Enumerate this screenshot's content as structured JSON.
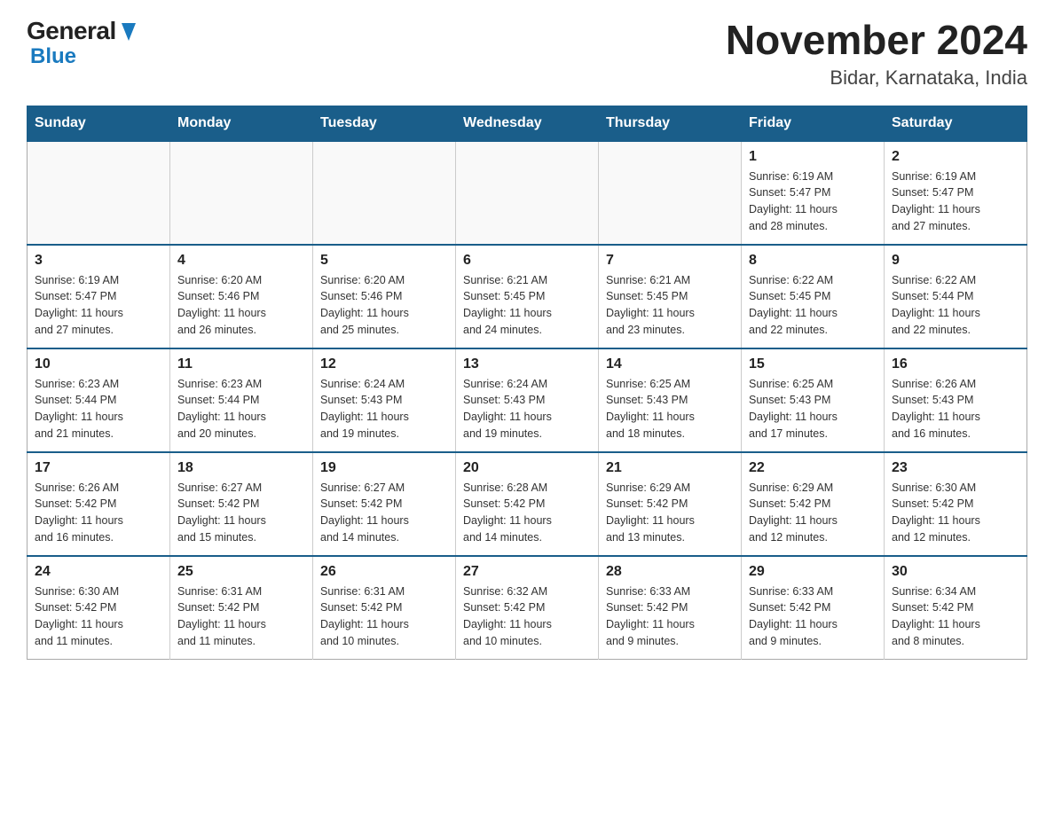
{
  "logo": {
    "general": "General",
    "blue": "Blue"
  },
  "title": "November 2024",
  "subtitle": "Bidar, Karnataka, India",
  "weekdays": [
    "Sunday",
    "Monday",
    "Tuesday",
    "Wednesday",
    "Thursday",
    "Friday",
    "Saturday"
  ],
  "weeks": [
    [
      {
        "day": "",
        "info": ""
      },
      {
        "day": "",
        "info": ""
      },
      {
        "day": "",
        "info": ""
      },
      {
        "day": "",
        "info": ""
      },
      {
        "day": "",
        "info": ""
      },
      {
        "day": "1",
        "info": "Sunrise: 6:19 AM\nSunset: 5:47 PM\nDaylight: 11 hours\nand 28 minutes."
      },
      {
        "day": "2",
        "info": "Sunrise: 6:19 AM\nSunset: 5:47 PM\nDaylight: 11 hours\nand 27 minutes."
      }
    ],
    [
      {
        "day": "3",
        "info": "Sunrise: 6:19 AM\nSunset: 5:47 PM\nDaylight: 11 hours\nand 27 minutes."
      },
      {
        "day": "4",
        "info": "Sunrise: 6:20 AM\nSunset: 5:46 PM\nDaylight: 11 hours\nand 26 minutes."
      },
      {
        "day": "5",
        "info": "Sunrise: 6:20 AM\nSunset: 5:46 PM\nDaylight: 11 hours\nand 25 minutes."
      },
      {
        "day": "6",
        "info": "Sunrise: 6:21 AM\nSunset: 5:45 PM\nDaylight: 11 hours\nand 24 minutes."
      },
      {
        "day": "7",
        "info": "Sunrise: 6:21 AM\nSunset: 5:45 PM\nDaylight: 11 hours\nand 23 minutes."
      },
      {
        "day": "8",
        "info": "Sunrise: 6:22 AM\nSunset: 5:45 PM\nDaylight: 11 hours\nand 22 minutes."
      },
      {
        "day": "9",
        "info": "Sunrise: 6:22 AM\nSunset: 5:44 PM\nDaylight: 11 hours\nand 22 minutes."
      }
    ],
    [
      {
        "day": "10",
        "info": "Sunrise: 6:23 AM\nSunset: 5:44 PM\nDaylight: 11 hours\nand 21 minutes."
      },
      {
        "day": "11",
        "info": "Sunrise: 6:23 AM\nSunset: 5:44 PM\nDaylight: 11 hours\nand 20 minutes."
      },
      {
        "day": "12",
        "info": "Sunrise: 6:24 AM\nSunset: 5:43 PM\nDaylight: 11 hours\nand 19 minutes."
      },
      {
        "day": "13",
        "info": "Sunrise: 6:24 AM\nSunset: 5:43 PM\nDaylight: 11 hours\nand 19 minutes."
      },
      {
        "day": "14",
        "info": "Sunrise: 6:25 AM\nSunset: 5:43 PM\nDaylight: 11 hours\nand 18 minutes."
      },
      {
        "day": "15",
        "info": "Sunrise: 6:25 AM\nSunset: 5:43 PM\nDaylight: 11 hours\nand 17 minutes."
      },
      {
        "day": "16",
        "info": "Sunrise: 6:26 AM\nSunset: 5:43 PM\nDaylight: 11 hours\nand 16 minutes."
      }
    ],
    [
      {
        "day": "17",
        "info": "Sunrise: 6:26 AM\nSunset: 5:42 PM\nDaylight: 11 hours\nand 16 minutes."
      },
      {
        "day": "18",
        "info": "Sunrise: 6:27 AM\nSunset: 5:42 PM\nDaylight: 11 hours\nand 15 minutes."
      },
      {
        "day": "19",
        "info": "Sunrise: 6:27 AM\nSunset: 5:42 PM\nDaylight: 11 hours\nand 14 minutes."
      },
      {
        "day": "20",
        "info": "Sunrise: 6:28 AM\nSunset: 5:42 PM\nDaylight: 11 hours\nand 14 minutes."
      },
      {
        "day": "21",
        "info": "Sunrise: 6:29 AM\nSunset: 5:42 PM\nDaylight: 11 hours\nand 13 minutes."
      },
      {
        "day": "22",
        "info": "Sunrise: 6:29 AM\nSunset: 5:42 PM\nDaylight: 11 hours\nand 12 minutes."
      },
      {
        "day": "23",
        "info": "Sunrise: 6:30 AM\nSunset: 5:42 PM\nDaylight: 11 hours\nand 12 minutes."
      }
    ],
    [
      {
        "day": "24",
        "info": "Sunrise: 6:30 AM\nSunset: 5:42 PM\nDaylight: 11 hours\nand 11 minutes."
      },
      {
        "day": "25",
        "info": "Sunrise: 6:31 AM\nSunset: 5:42 PM\nDaylight: 11 hours\nand 11 minutes."
      },
      {
        "day": "26",
        "info": "Sunrise: 6:31 AM\nSunset: 5:42 PM\nDaylight: 11 hours\nand 10 minutes."
      },
      {
        "day": "27",
        "info": "Sunrise: 6:32 AM\nSunset: 5:42 PM\nDaylight: 11 hours\nand 10 minutes."
      },
      {
        "day": "28",
        "info": "Sunrise: 6:33 AM\nSunset: 5:42 PM\nDaylight: 11 hours\nand 9 minutes."
      },
      {
        "day": "29",
        "info": "Sunrise: 6:33 AM\nSunset: 5:42 PM\nDaylight: 11 hours\nand 9 minutes."
      },
      {
        "day": "30",
        "info": "Sunrise: 6:34 AM\nSunset: 5:42 PM\nDaylight: 11 hours\nand 8 minutes."
      }
    ]
  ]
}
